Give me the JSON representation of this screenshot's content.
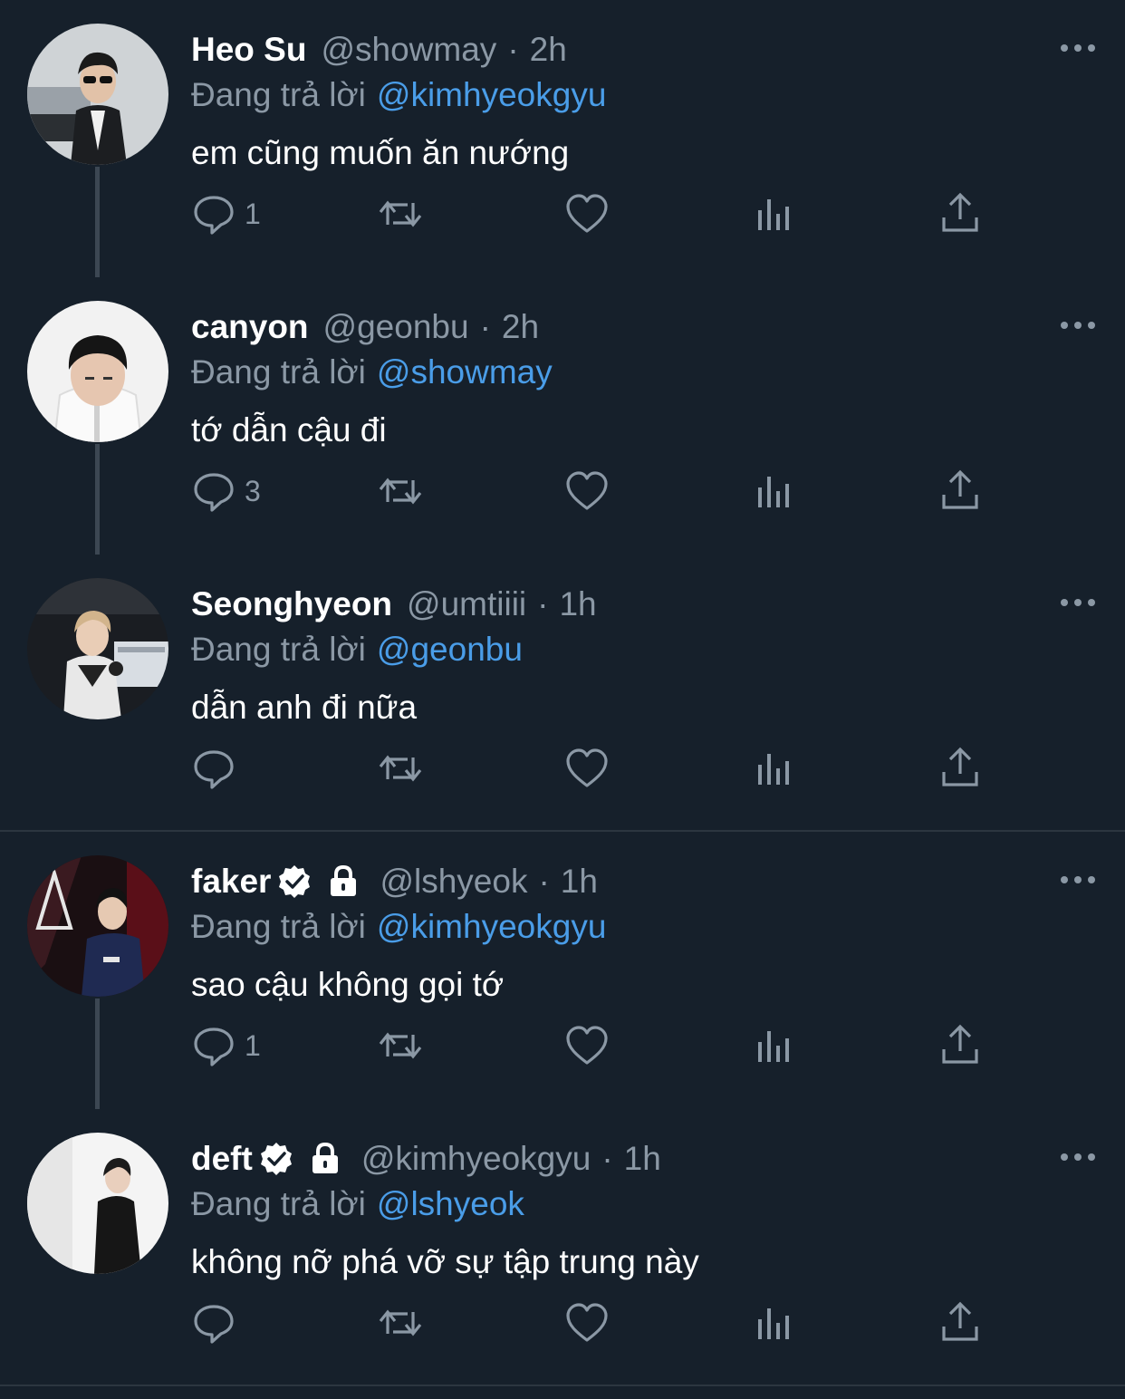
{
  "colors": {
    "background": "#16202b",
    "muted": "#8b98a5",
    "link": "#4a9de8",
    "divider": "#2c3640",
    "thread": "#3c4753"
  },
  "reply_prefix": "Đang trả lời",
  "tweets": [
    {
      "name": "Heo Su",
      "handle": "@showmay",
      "separator": "·",
      "time": "2h",
      "reply_to": "@kimhyeokgyu",
      "text": "em cũng muốn ăn nướng",
      "reply_count": "1",
      "verified": false,
      "protected": false,
      "avatar_icon": "avatar-photo"
    },
    {
      "name": "canyon",
      "handle": "@geonbu",
      "separator": "·",
      "time": "2h",
      "reply_to": "@showmay",
      "text": "tớ dẫn cậu đi",
      "reply_count": "3",
      "verified": false,
      "protected": false,
      "avatar_icon": "avatar-photo"
    },
    {
      "name": "Seonghyeon",
      "handle": "@umtiiii",
      "separator": "·",
      "time": "1h",
      "reply_to": "@geonbu",
      "text": "dẫn anh đi nữa",
      "reply_count": "",
      "verified": false,
      "protected": false,
      "avatar_icon": "avatar-photo"
    },
    {
      "name": "faker",
      "handle": "@lshyeok",
      "separator": "·",
      "time": "1h",
      "reply_to": "@kimhyeokgyu",
      "text": "sao cậu không gọi tớ",
      "reply_count": "1",
      "verified": true,
      "protected": true,
      "avatar_icon": "avatar-photo"
    },
    {
      "name": "deft",
      "handle": "@kimhyeokgyu",
      "separator": "·",
      "time": "1h",
      "reply_to": "@lshyeok",
      "text": "không nỡ phá vỡ sự tập trung này",
      "reply_count": "",
      "verified": true,
      "protected": true,
      "avatar_icon": "avatar-photo"
    }
  ],
  "icons": {
    "reply": "reply-icon",
    "retweet": "retweet-icon",
    "like": "heart-icon",
    "stats": "stats-icon",
    "share": "share-icon",
    "more": "more-icon",
    "verified": "verified-badge-icon",
    "protected": "lock-icon"
  }
}
